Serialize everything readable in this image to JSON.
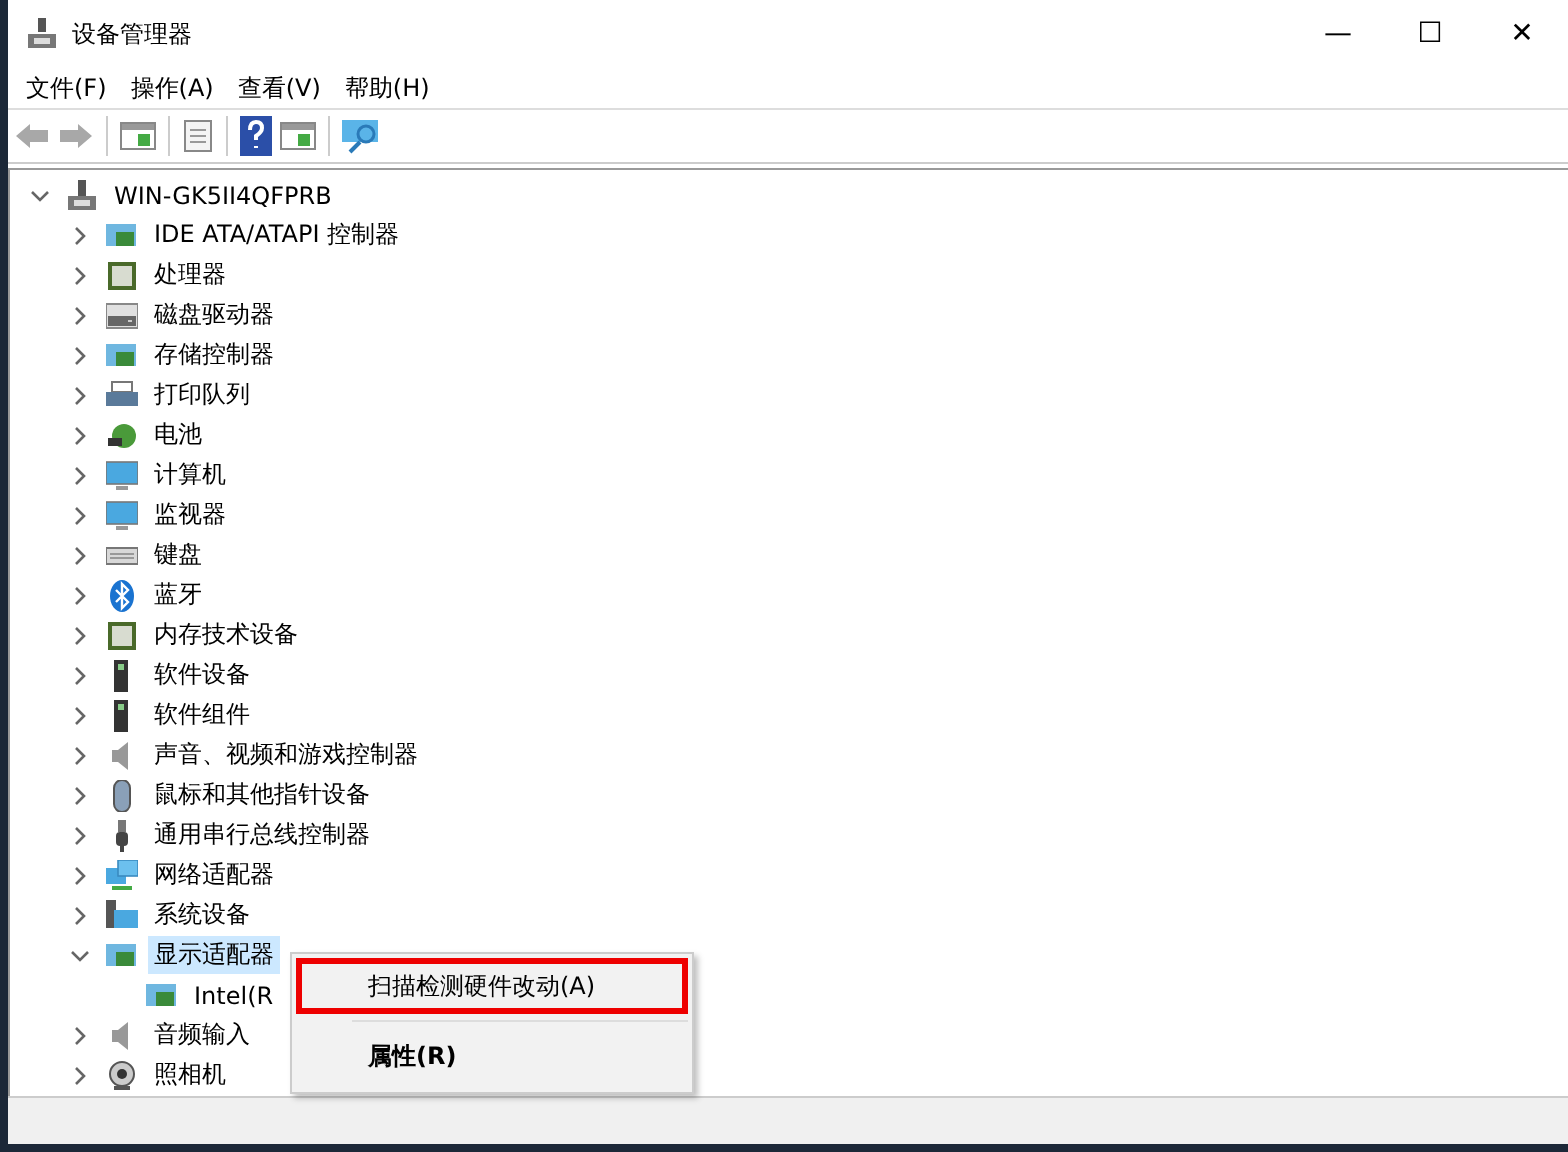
{
  "window": {
    "title": "设备管理器",
    "controls": [
      "—",
      "☐",
      "✕"
    ]
  },
  "menu": [
    {
      "label": "文件(F)"
    },
    {
      "label": "操作(A)"
    },
    {
      "label": "查看(V)"
    },
    {
      "label": "帮助(H)"
    }
  ],
  "toolbar": [
    {
      "kind": "back",
      "disabled": true
    },
    {
      "kind": "forward",
      "disabled": true
    },
    {
      "kind": "sep"
    },
    {
      "kind": "panel",
      "disabled": false
    },
    {
      "kind": "sep"
    },
    {
      "kind": "sheet",
      "disabled": false
    },
    {
      "kind": "sep"
    },
    {
      "kind": "help",
      "disabled": false
    },
    {
      "kind": "panel",
      "disabled": false
    },
    {
      "kind": "sep"
    },
    {
      "kind": "monitor",
      "disabled": false
    }
  ],
  "tree": {
    "label": "WIN-GK5II4QFPRB",
    "expanded": true,
    "selected": false,
    "children": [
      {
        "label": "IDE ATA/ATAPI 控制器",
        "expanded": false,
        "selected": false
      },
      {
        "label": "处理器",
        "expanded": false,
        "selected": false
      },
      {
        "label": "磁盘驱动器",
        "expanded": false,
        "selected": false
      },
      {
        "label": "存储控制器",
        "expanded": false,
        "selected": false
      },
      {
        "label": "打印队列",
        "expanded": false,
        "selected": false
      },
      {
        "label": "电池",
        "expanded": false,
        "selected": false
      },
      {
        "label": "计算机",
        "expanded": false,
        "selected": false
      },
      {
        "label": "监视器",
        "expanded": false,
        "selected": false
      },
      {
        "label": "键盘",
        "expanded": false,
        "selected": false
      },
      {
        "label": "蓝牙",
        "expanded": false,
        "selected": false
      },
      {
        "label": "内存技术设备",
        "expanded": false,
        "selected": false
      },
      {
        "label": "软件设备",
        "expanded": false,
        "selected": false
      },
      {
        "label": "软件组件",
        "expanded": false,
        "selected": false
      },
      {
        "label": "声音、视频和游戏控制器",
        "expanded": false,
        "selected": false
      },
      {
        "label": "鼠标和其他指针设备",
        "expanded": false,
        "selected": false
      },
      {
        "label": "通用串行总线控制器",
        "expanded": false,
        "selected": false
      },
      {
        "label": "网络适配器",
        "expanded": false,
        "selected": false
      },
      {
        "label": "系统设备",
        "expanded": false,
        "selected": false
      },
      {
        "label": "显示适配器",
        "expanded": true,
        "selected": true,
        "children": [
          {
            "label": "Intel(R",
            "selected": false
          }
        ]
      },
      {
        "label": "音频输入",
        "expanded": false,
        "selected": false
      },
      {
        "label": "照相机",
        "expanded": false,
        "selected": false
      }
    ]
  },
  "context_menu": [
    {
      "label": "扫描检测硬件改动(A)",
      "marked": true,
      "bold": false
    },
    {
      "label": "属性(R)",
      "marked": false,
      "bold": true
    }
  ]
}
